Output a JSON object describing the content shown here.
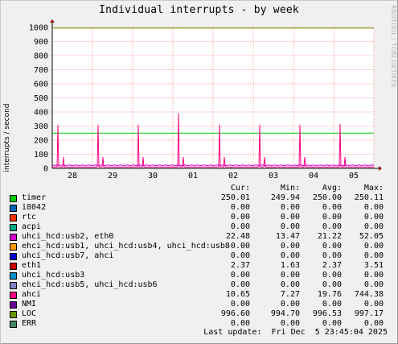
{
  "chart_data": {
    "type": "line",
    "title": "Individual interrupts - by week",
    "ylabel": "interrupts / second",
    "xlabel": "",
    "ylim": [
      0,
      1000
    ],
    "yticks": [
      0,
      100,
      200,
      300,
      400,
      500,
      600,
      700,
      800,
      900,
      1000
    ],
    "xticks": [
      "28",
      "29",
      "30",
      "01",
      "02",
      "03",
      "04",
      "05"
    ],
    "x_range_days": [
      0,
      8
    ],
    "x_tick_days": [
      0.5,
      1.5,
      2.5,
      3.5,
      4.5,
      5.5,
      6.5,
      7.5
    ],
    "grid": true,
    "legend_position": "bottom",
    "vendor_text": "RRDTOOL / TOBI OETIKER",
    "series": [
      {
        "name": "timer",
        "color": "#00cc00",
        "points": [
          [
            0,
            250
          ],
          [
            8,
            250
          ]
        ]
      },
      {
        "name": "LOC",
        "color": "#669900",
        "points": [
          [
            0,
            995
          ],
          [
            8,
            995
          ]
        ]
      },
      {
        "name": "ahci",
        "color": "#ff0080",
        "spike_days": [
          0.15,
          1.15,
          2.15,
          3.15,
          4.15,
          5.15,
          6.15,
          7.15
        ],
        "spike_values": [
          310,
          310,
          310,
          390,
          310,
          310,
          310,
          315
        ],
        "baseline": 10
      },
      {
        "name": "uhci_hcd:usb2, eth0",
        "color": "#cc00cc",
        "baseline": 22
      }
    ]
  },
  "legend": {
    "headers": [
      "Cur:",
      "Min:",
      "Avg:",
      "Max:"
    ],
    "rows": [
      {
        "name": "timer",
        "color": "#00cc00",
        "cur": "250.01",
        "min": "249.94",
        "avg": "250.00",
        "max": "250.11"
      },
      {
        "name": "i8042",
        "color": "#0066b3",
        "cur": "0.00",
        "min": "0.00",
        "avg": "0.00",
        "max": "0.00"
      },
      {
        "name": "rtc",
        "color": "#ff3300",
        "cur": "0.00",
        "min": "0.00",
        "avg": "0.00",
        "max": "0.00"
      },
      {
        "name": "acpi",
        "color": "#00aa88",
        "cur": "0.00",
        "min": "0.00",
        "avg": "0.00",
        "max": "0.00"
      },
      {
        "name": "uhci_hcd:usb2, eth0",
        "color": "#cc00cc",
        "cur": "22.48",
        "min": "13.47",
        "avg": "21.22",
        "max": "52.05"
      },
      {
        "name": "ehci_hcd:usb1, uhci_hcd:usb4, uhci_hcd:usb8",
        "color": "#ff9900",
        "cur": "0.00",
        "min": "0.00",
        "avg": "0.00",
        "max": "0.00"
      },
      {
        "name": "uhci_hcd:usb7, ahci",
        "color": "#0000cc",
        "cur": "0.00",
        "min": "0.00",
        "avg": "0.00",
        "max": "0.00"
      },
      {
        "name": "eth1",
        "color": "#cc0000",
        "cur": "2.37",
        "min": "1.63",
        "avg": "2.37",
        "max": "3.51"
      },
      {
        "name": "uhci_hcd:usb3",
        "color": "#008fcc",
        "cur": "0.00",
        "min": "0.00",
        "avg": "0.00",
        "max": "0.00"
      },
      {
        "name": "ehci_hcd:usb5, uhci_hcd:usb6",
        "color": "#8080c0",
        "cur": "0.00",
        "min": "0.00",
        "avg": "0.00",
        "max": "0.00"
      },
      {
        "name": "ahci",
        "color": "#ff0080",
        "cur": "10.65",
        "min": "7.27",
        "avg": "19.76",
        "max": "744.38"
      },
      {
        "name": "NMI",
        "color": "#660099",
        "cur": "0.00",
        "min": "0.00",
        "avg": "0.00",
        "max": "0.00"
      },
      {
        "name": "LOC",
        "color": "#669900",
        "cur": "996.60",
        "min": "994.70",
        "avg": "996.53",
        "max": "997.17"
      },
      {
        "name": "ERR",
        "color": "#448866",
        "cur": "0.00",
        "min": "0.00",
        "avg": "0.00",
        "max": "0.00"
      }
    ]
  },
  "last_update": "Last update:  Fri Dec  5 23:45:04 2025"
}
